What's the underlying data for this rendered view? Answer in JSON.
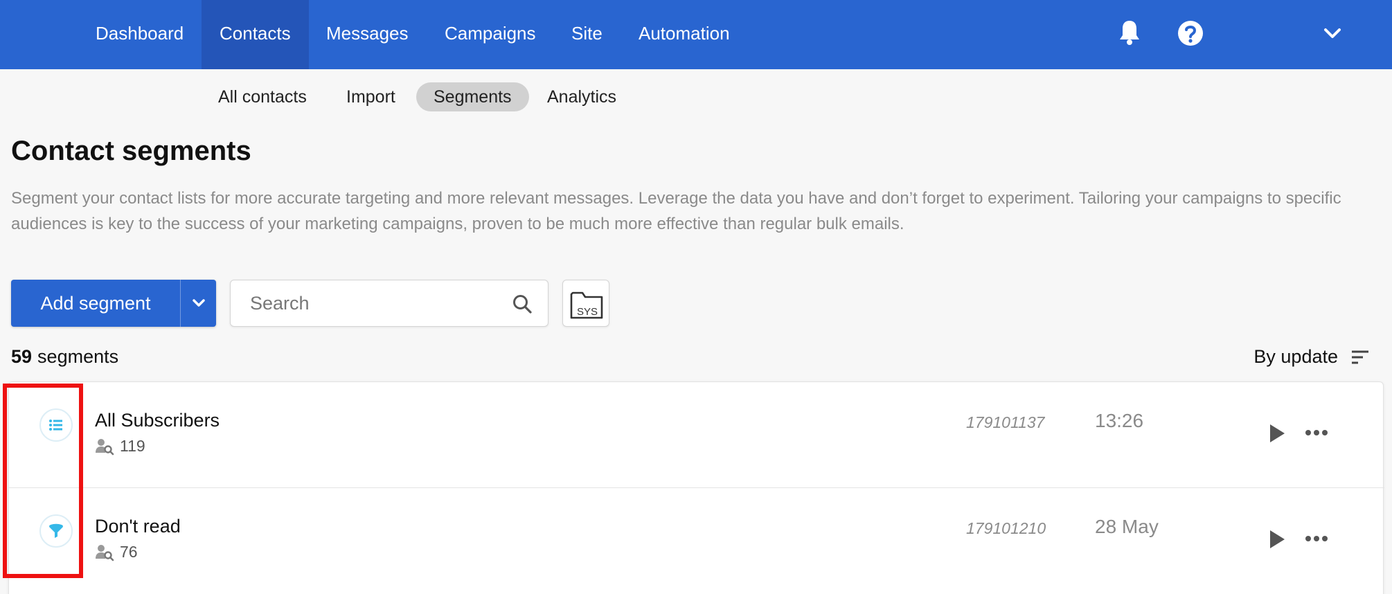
{
  "nav": {
    "items": [
      {
        "label": "Dashboard"
      },
      {
        "label": "Contacts"
      },
      {
        "label": "Messages"
      },
      {
        "label": "Campaigns"
      },
      {
        "label": "Site"
      },
      {
        "label": "Automation"
      }
    ],
    "active": "Contacts",
    "icons": [
      "bell-icon",
      "help-icon",
      "chevron-down-icon"
    ]
  },
  "subnav": {
    "items": [
      {
        "label": "All contacts"
      },
      {
        "label": "Import"
      },
      {
        "label": "Segments"
      },
      {
        "label": "Analytics"
      }
    ],
    "active": "Segments"
  },
  "page": {
    "title": "Contact segments",
    "description": "Segment your contact lists for more accurate targeting and more relevant messages. Leverage the data you have and don’t forget to experiment. Tailoring your campaigns to specific audiences is key to the success of your marketing campaigns, proven to be much more effective than regular bulk emails."
  },
  "toolbar": {
    "add_label": "Add segment",
    "search_placeholder": "Search",
    "sys_label": "SYS"
  },
  "summary": {
    "count": "59",
    "unit": "segments",
    "sort_label": "By update"
  },
  "segments": [
    {
      "name": "All Subscribers",
      "contacts": "119",
      "id": "179101137",
      "updated": "13:26",
      "icon": "list-icon"
    },
    {
      "name": "Don't read",
      "contacts": "76",
      "id": "179101210",
      "updated": "28 May",
      "icon": "filter-icon"
    }
  ],
  "colors": {
    "brand_blue": "#2965d0",
    "nav_active": "#2455b8",
    "icon_accent": "#35b8e8",
    "highlight": "#ee1111"
  }
}
